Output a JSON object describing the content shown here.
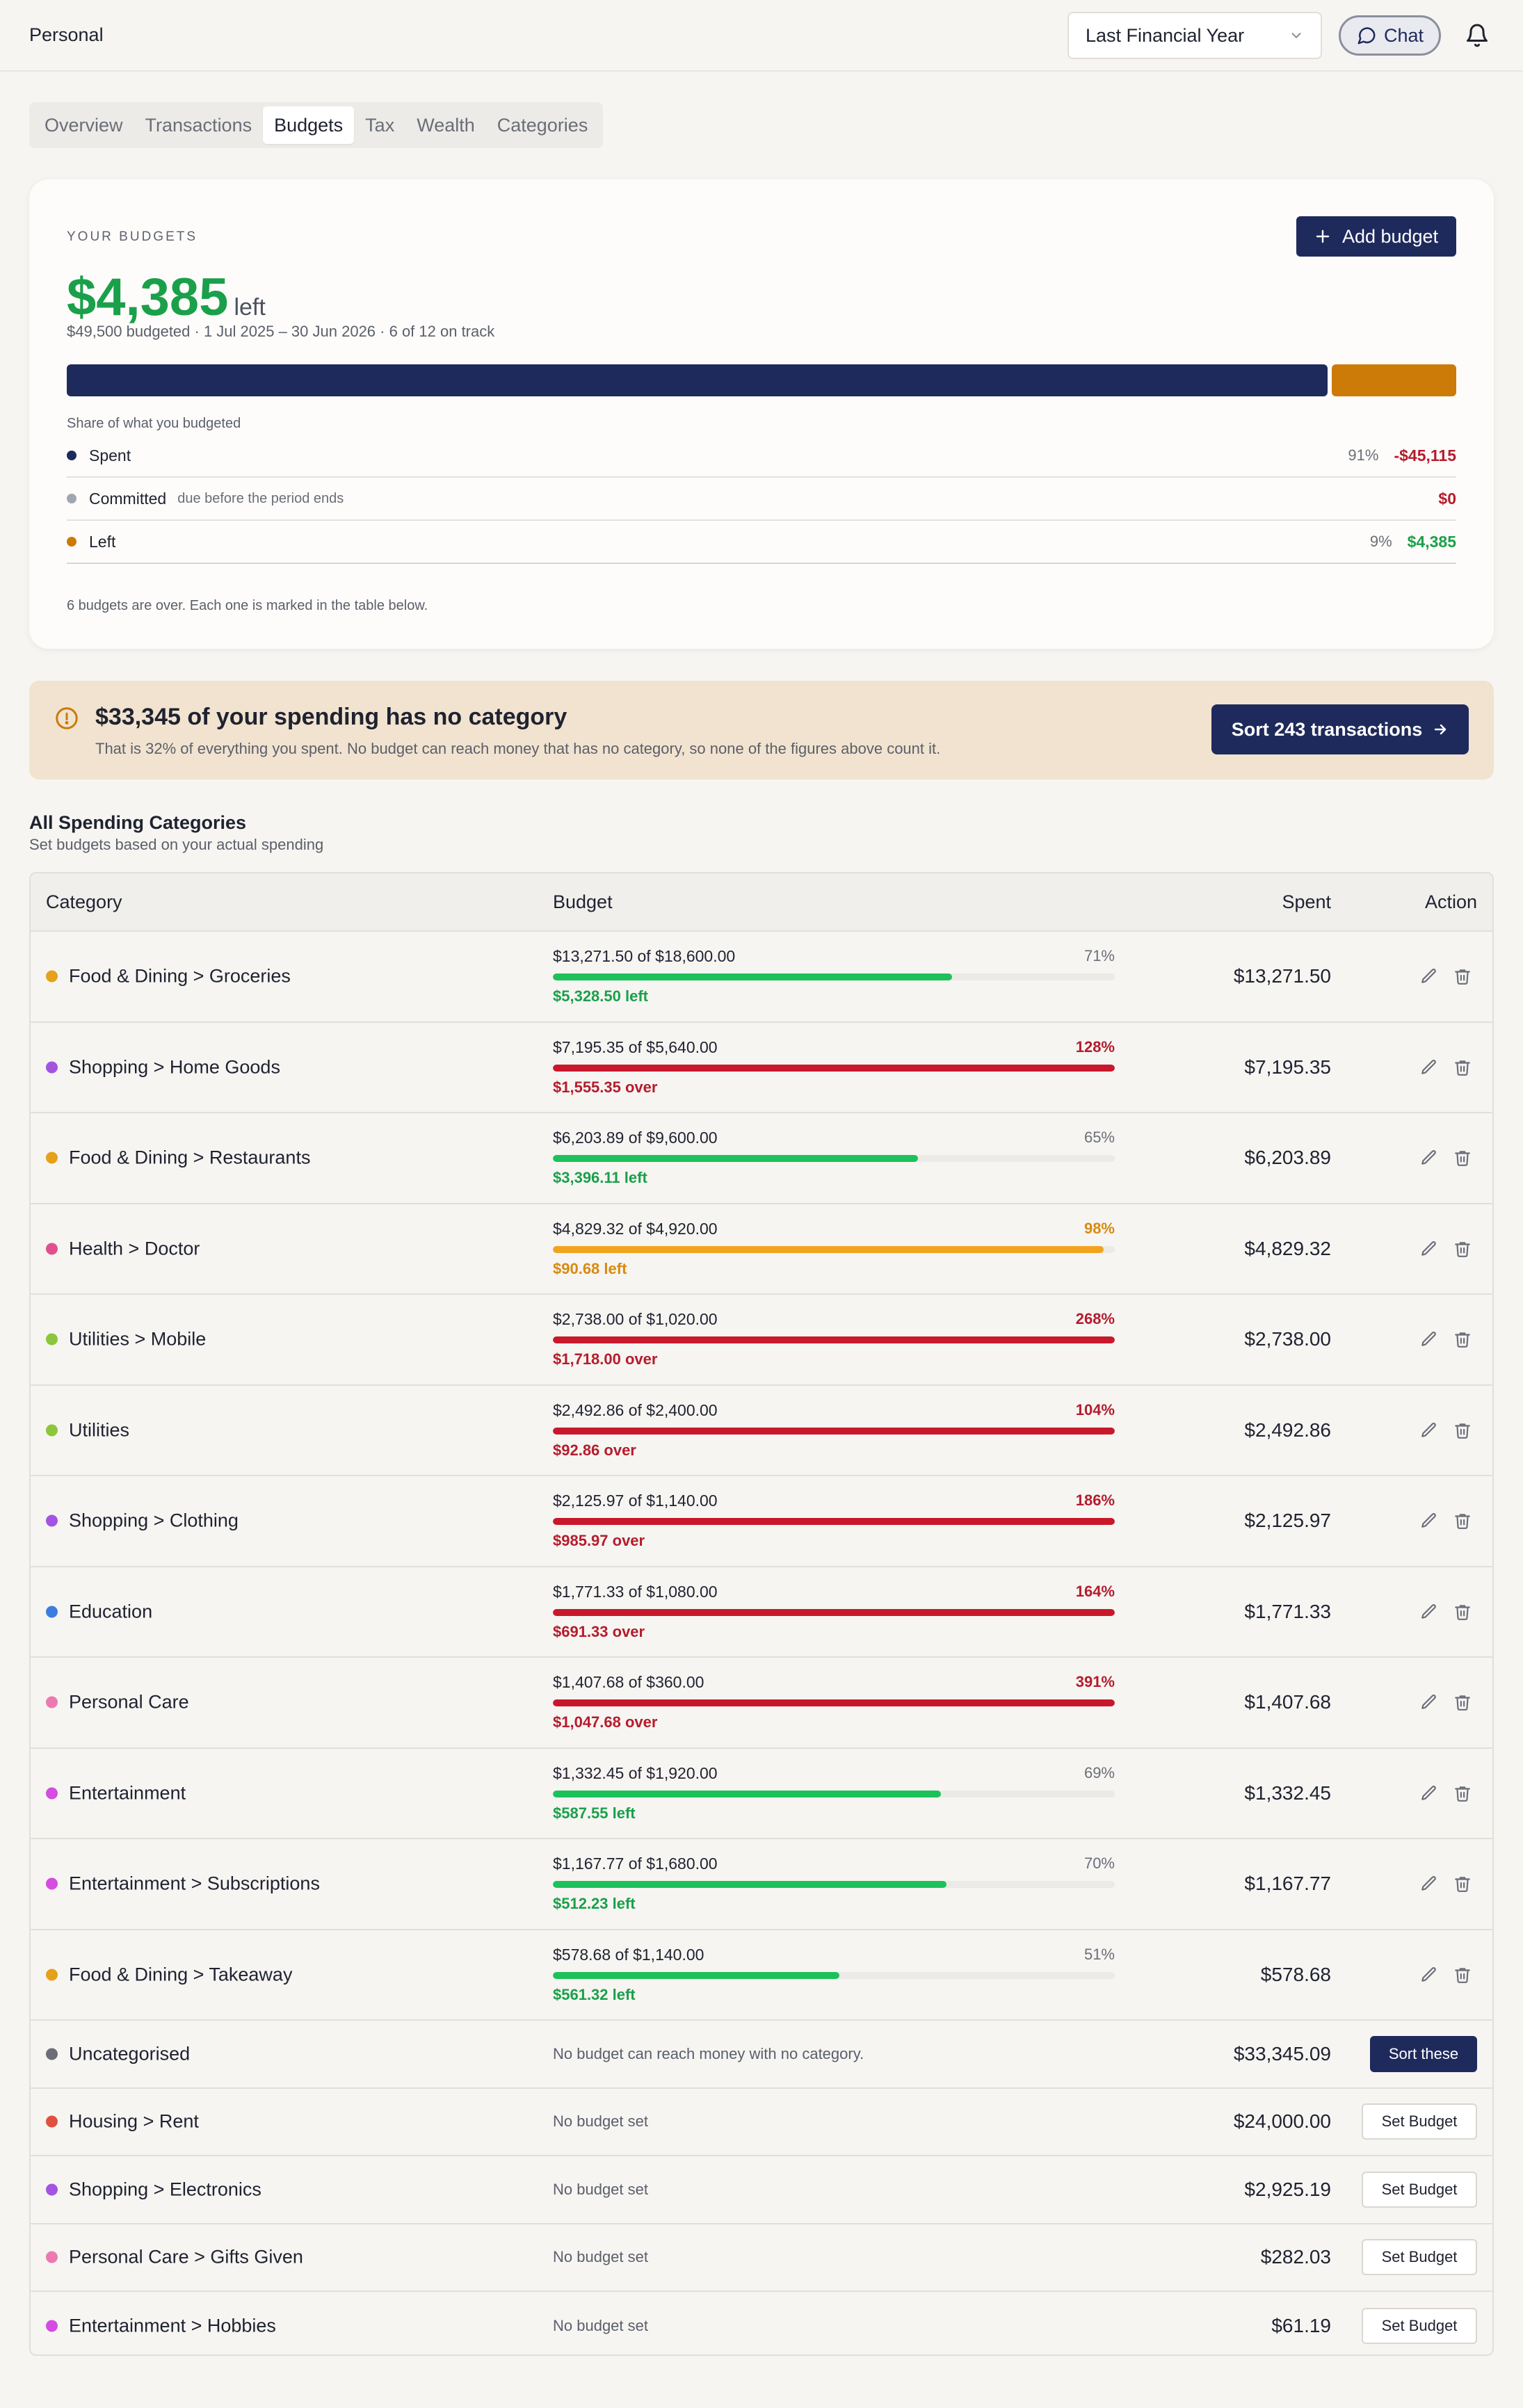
{
  "app": {
    "title": "Personal"
  },
  "header": {
    "period": "Last Financial Year",
    "chat_label": "Chat"
  },
  "tabs": [
    {
      "label": "Overview",
      "active": false
    },
    {
      "label": "Transactions",
      "active": false
    },
    {
      "label": "Budgets",
      "active": true
    },
    {
      "label": "Tax",
      "active": false
    },
    {
      "label": "Wealth",
      "active": false
    },
    {
      "label": "Categories",
      "active": false
    }
  ],
  "summary": {
    "eyebrow": "YOUR BUDGETS",
    "add_budget_label": "Add budget",
    "left_amount": "$4,385",
    "left_suffix": "left",
    "subline": "$49,500 budgeted · 1 Jul 2025 – 30 Jun 2026 · 6 of 12 on track",
    "share_label": "Share of what you budgeted",
    "progress": {
      "spent_pct": 91,
      "committed_pct": 0,
      "left_pct": 9
    },
    "legend": [
      {
        "label": "Spent",
        "note": "",
        "pct": "91%",
        "value": "-$45,115",
        "color": "#1f2a5c",
        "value_color": "#b51c2c"
      },
      {
        "label": "Committed",
        "note": "due before the period ends",
        "pct": "",
        "value": "$0",
        "color": "#a2a6b3",
        "value_color": "#b51c2c"
      },
      {
        "label": "Left",
        "note": "",
        "pct": "9%",
        "value": "$4,385",
        "color": "#cc7a08",
        "value_color": "#1aa04a"
      }
    ],
    "footnote": "6 budgets are over. Each one is marked in the table below."
  },
  "banner": {
    "title": "$33,345 of your spending has no category",
    "text": "That is 32% of everything you spent. No budget can reach money that has no category, so none of the figures above count it.",
    "button_label": "Sort 243 transactions"
  },
  "section": {
    "title": "All Spending Categories",
    "subtitle": "Set budgets based on your actual spending"
  },
  "table": {
    "headers": {
      "category": "Category",
      "budget": "Budget",
      "spent": "Spent",
      "action": "Action"
    },
    "budget_rows": [
      {
        "category": "Food & Dining > Groceries",
        "dot": "#e6a11a",
        "budget": "$13,271.50 of $18,600.00",
        "pct": "71%",
        "fill": 0.71,
        "status": "ok",
        "note": "$5,328.50 left",
        "spent": "$13,271.50"
      },
      {
        "category": "Shopping > Home Goods",
        "dot": "#a354e0",
        "budget": "$7,195.35 of $5,640.00",
        "pct": "128%",
        "fill": 1.0,
        "status": "over",
        "note": "$1,555.35 over",
        "spent": "$7,195.35"
      },
      {
        "category": "Food & Dining > Restaurants",
        "dot": "#e6a11a",
        "budget": "$6,203.89 of $9,600.00",
        "pct": "65%",
        "fill": 0.65,
        "status": "ok",
        "note": "$3,396.11 left",
        "spent": "$6,203.89"
      },
      {
        "category": "Health > Doctor",
        "dot": "#e0508f",
        "budget": "$4,829.32 of $4,920.00",
        "pct": "98%",
        "fill": 0.98,
        "status": "warn",
        "note": "$90.68 left",
        "spent": "$4,829.32"
      },
      {
        "category": "Utilities > Mobile",
        "dot": "#8cc63a",
        "budget": "$2,738.00 of $1,020.00",
        "pct": "268%",
        "fill": 1.0,
        "status": "over",
        "note": "$1,718.00 over",
        "spent": "$2,738.00"
      },
      {
        "category": "Utilities",
        "dot": "#8cc63a",
        "budget": "$2,492.86 of $2,400.00",
        "pct": "104%",
        "fill": 1.0,
        "status": "over",
        "note": "$92.86 over",
        "spent": "$2,492.86"
      },
      {
        "category": "Shopping > Clothing",
        "dot": "#a354e0",
        "budget": "$2,125.97 of $1,140.00",
        "pct": "186%",
        "fill": 1.0,
        "status": "over",
        "note": "$985.97 over",
        "spent": "$2,125.97"
      },
      {
        "category": "Education",
        "dot": "#3d7de0",
        "budget": "$1,771.33 of $1,080.00",
        "pct": "164%",
        "fill": 1.0,
        "status": "over",
        "note": "$691.33 over",
        "spent": "$1,771.33"
      },
      {
        "category": "Personal Care",
        "dot": "#ec7ab0",
        "budget": "$1,407.68 of $360.00",
        "pct": "391%",
        "fill": 1.0,
        "status": "over",
        "note": "$1,047.68 over",
        "spent": "$1,407.68"
      },
      {
        "category": "Entertainment",
        "dot": "#d64be0",
        "budget": "$1,332.45 of $1,920.00",
        "pct": "69%",
        "fill": 0.69,
        "status": "ok",
        "note": "$587.55 left",
        "spent": "$1,332.45"
      },
      {
        "category": "Entertainment > Subscriptions",
        "dot": "#d64be0",
        "budget": "$1,167.77 of $1,680.00",
        "pct": "70%",
        "fill": 0.7,
        "status": "ok",
        "note": "$512.23 left",
        "spent": "$1,167.77"
      },
      {
        "category": "Food & Dining > Takeaway",
        "dot": "#e6a11a",
        "budget": "$578.68 of $1,140.00",
        "pct": "51%",
        "fill": 0.51,
        "status": "ok",
        "note": "$561.32 left",
        "spent": "$578.68"
      }
    ],
    "simple_rows": [
      {
        "category": "Uncategorised",
        "dot": "#6b6e78",
        "message": "No budget can reach money with no category.",
        "spent": "$33,345.09",
        "button": "Sort these",
        "style": "dark"
      },
      {
        "category": "Housing > Rent",
        "dot": "#e05040",
        "message": "No budget set",
        "spent": "$24,000.00",
        "button": "Set Budget",
        "style": "light"
      },
      {
        "category": "Shopping > Electronics",
        "dot": "#a354e0",
        "message": "No budget set",
        "spent": "$2,925.19",
        "button": "Set Budget",
        "style": "light"
      },
      {
        "category": "Personal Care > Gifts Given",
        "dot": "#ec7ab0",
        "message": "No budget set",
        "spent": "$282.03",
        "button": "Set Budget",
        "style": "light"
      },
      {
        "category": "Entertainment > Hobbies",
        "dot": "#d64be0",
        "message": "No budget set",
        "spent": "$61.19",
        "button": "Set Budget",
        "style": "light"
      }
    ]
  },
  "colors": {
    "ok_bar": "#1dc15a",
    "ok_text": "#1aa04a",
    "over_bar": "#c8182b",
    "over_text": "#b51c2c",
    "warn_bar": "#f2a31e",
    "warn_text": "#d98a10",
    "spent_bar": "#1f2a5c",
    "left_bar": "#cc7a08",
    "neutral_pct": "#6b6e78"
  }
}
